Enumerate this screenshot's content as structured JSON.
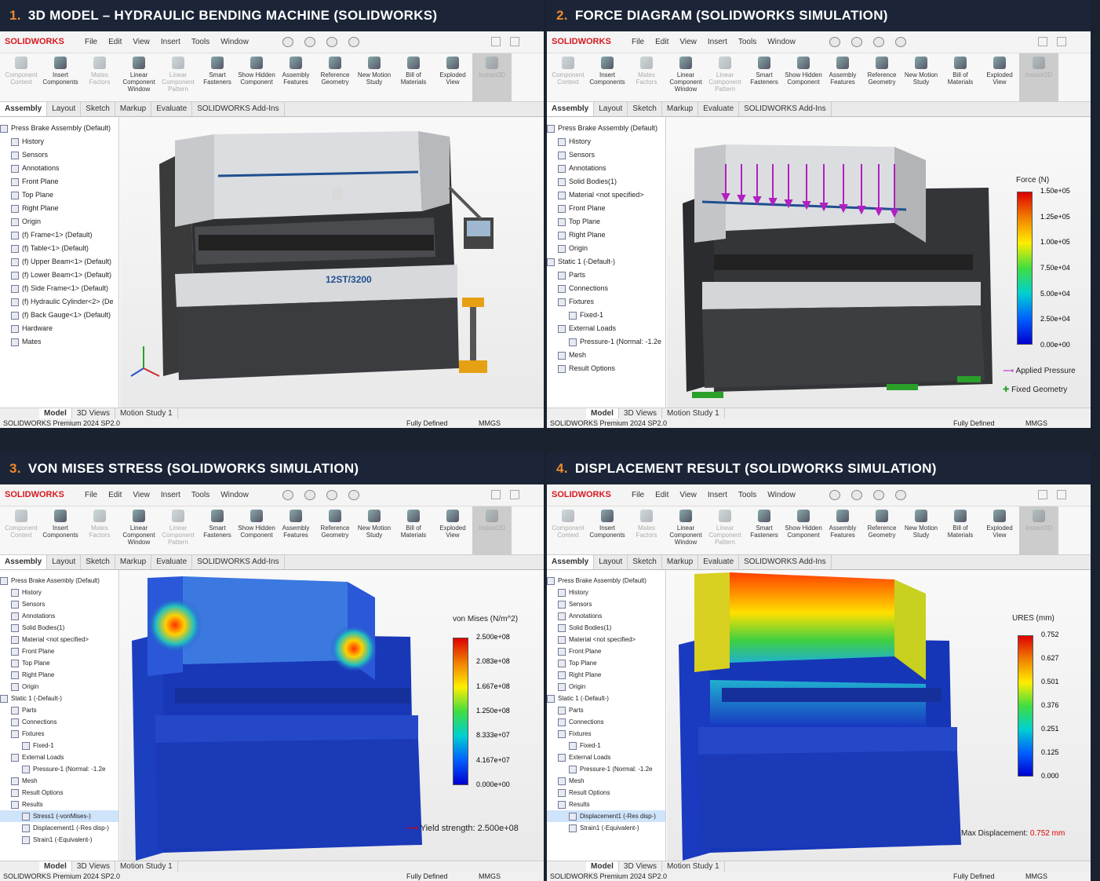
{
  "quadrants": [
    {
      "num": "1.",
      "title": "3D MODEL – HYDRAULIC BENDING MACHINE (SOLIDWORKS)"
    },
    {
      "num": "2.",
      "title": "FORCE DIAGRAM (SOLIDWORKS SIMULATION)"
    },
    {
      "num": "3.",
      "title": "VON MISES STRESS (SOLIDWORKS SIMULATION)"
    },
    {
      "num": "4.",
      "title": "DISPLACEMENT RESULT (SOLIDWORKS SIMULATION)"
    }
  ],
  "app": {
    "logo": "SOLIDWORKS",
    "menu": [
      "File",
      "Edit",
      "View",
      "Insert",
      "Tools",
      "Window"
    ],
    "ribbon": [
      {
        "label": "Component Context",
        "dim": true
      },
      {
        "label": "Insert Components",
        "dim": false
      },
      {
        "label": "Mates Factors",
        "dim": true
      },
      {
        "label": "Linear Component Window",
        "dim": false
      },
      {
        "label": "Linear Component Pattern",
        "dim": true
      },
      {
        "label": "Smart Fasteners",
        "dim": false
      },
      {
        "label": "Show Hidden Component",
        "dim": false
      },
      {
        "label": "Assembly Features",
        "dim": false
      },
      {
        "label": "Reference Geometry",
        "dim": false
      },
      {
        "label": "New Motion Study",
        "dim": false
      },
      {
        "label": "Bill of Materials",
        "dim": false
      },
      {
        "label": "Exploded View",
        "dim": false
      },
      {
        "label": "Instant3D",
        "dim": true,
        "active": true
      }
    ],
    "tabs": [
      "Assembly",
      "Layout",
      "Sketch",
      "Markup",
      "Evaluate",
      "SOLIDWORKS Add-Ins"
    ],
    "bottom_tabs": [
      "Model",
      "3D Views",
      "Motion Study 1"
    ],
    "status_left": "SOLIDWORKS Premium 2024 SP2.0",
    "status_mid": "Fully Defined",
    "status_units": "MMGS"
  },
  "tree1": [
    "Press Brake Assembly (Default)",
    "History",
    "Sensors",
    "Annotations",
    "Front Plane",
    "Top Plane",
    "Right Plane",
    "Origin",
    "(f) Frame<1> (Default)",
    "(f) Table<1> (Default)",
    "(f) Upper Beam<1> (Default)",
    "(f) Lower Beam<1> (Default)",
    "(f) Side Frame<1> (Default)",
    "(f) Hydraulic Cylinder<2> (De",
    "(f) Back Gauge<1> (Default)",
    "Hardware",
    "Mates"
  ],
  "tree_sim": [
    "Press Brake Assembly (Default)",
    "History",
    "Sensors",
    "Annotations",
    "Solid Bodies(1)",
    "Material <not specified>",
    "Front Plane",
    "Top Plane",
    "Right Plane",
    "Origin",
    "Static 1 (-Default-)",
    "Parts",
    "Connections",
    "Fixtures",
    "Fixed-1",
    "External Loads",
    "Pressure-1 (Normal: -1.2e",
    "Mesh",
    "Result Options"
  ],
  "tree_results3": [
    "Results",
    "Stress1 (-vonMises-)",
    "Displacement1 (-Res disp-)",
    "Strain1 (-Equivalent-)"
  ],
  "tree_results4": [
    "Results",
    "Displacement1 (-Res disp-)",
    "Strain1 (-Equivalent-)"
  ],
  "machine_label": "12ST/3200",
  "force_legend": {
    "title": "Force (N)",
    "ticks": [
      "1.50e+05",
      "1.25e+05",
      "1.00e+05",
      "7.50e+04",
      "5.00e+04",
      "2.50e+04",
      "0.00e+00"
    ],
    "applied": "Applied Pressure",
    "fixed": "Fixed Geometry",
    "accent": "#b020c0",
    "fixed_color": "#2aa02a"
  },
  "stress_legend": {
    "title": "von Mises (N/m^2)",
    "ticks": [
      "2.500e+08",
      "2.083e+08",
      "1.667e+08",
      "1.250e+08",
      "8.333e+07",
      "4.167e+07",
      "0.000e+00"
    ],
    "yield": "Yield strength: 2.500e+08"
  },
  "disp_legend": {
    "title": "URES (mm)",
    "ticks": [
      "0.752",
      "0.627",
      "0.501",
      "0.376",
      "0.251",
      "0.125",
      "0.000"
    ],
    "max_label": "Max Displacement:",
    "max_value": "0.752 mm"
  }
}
